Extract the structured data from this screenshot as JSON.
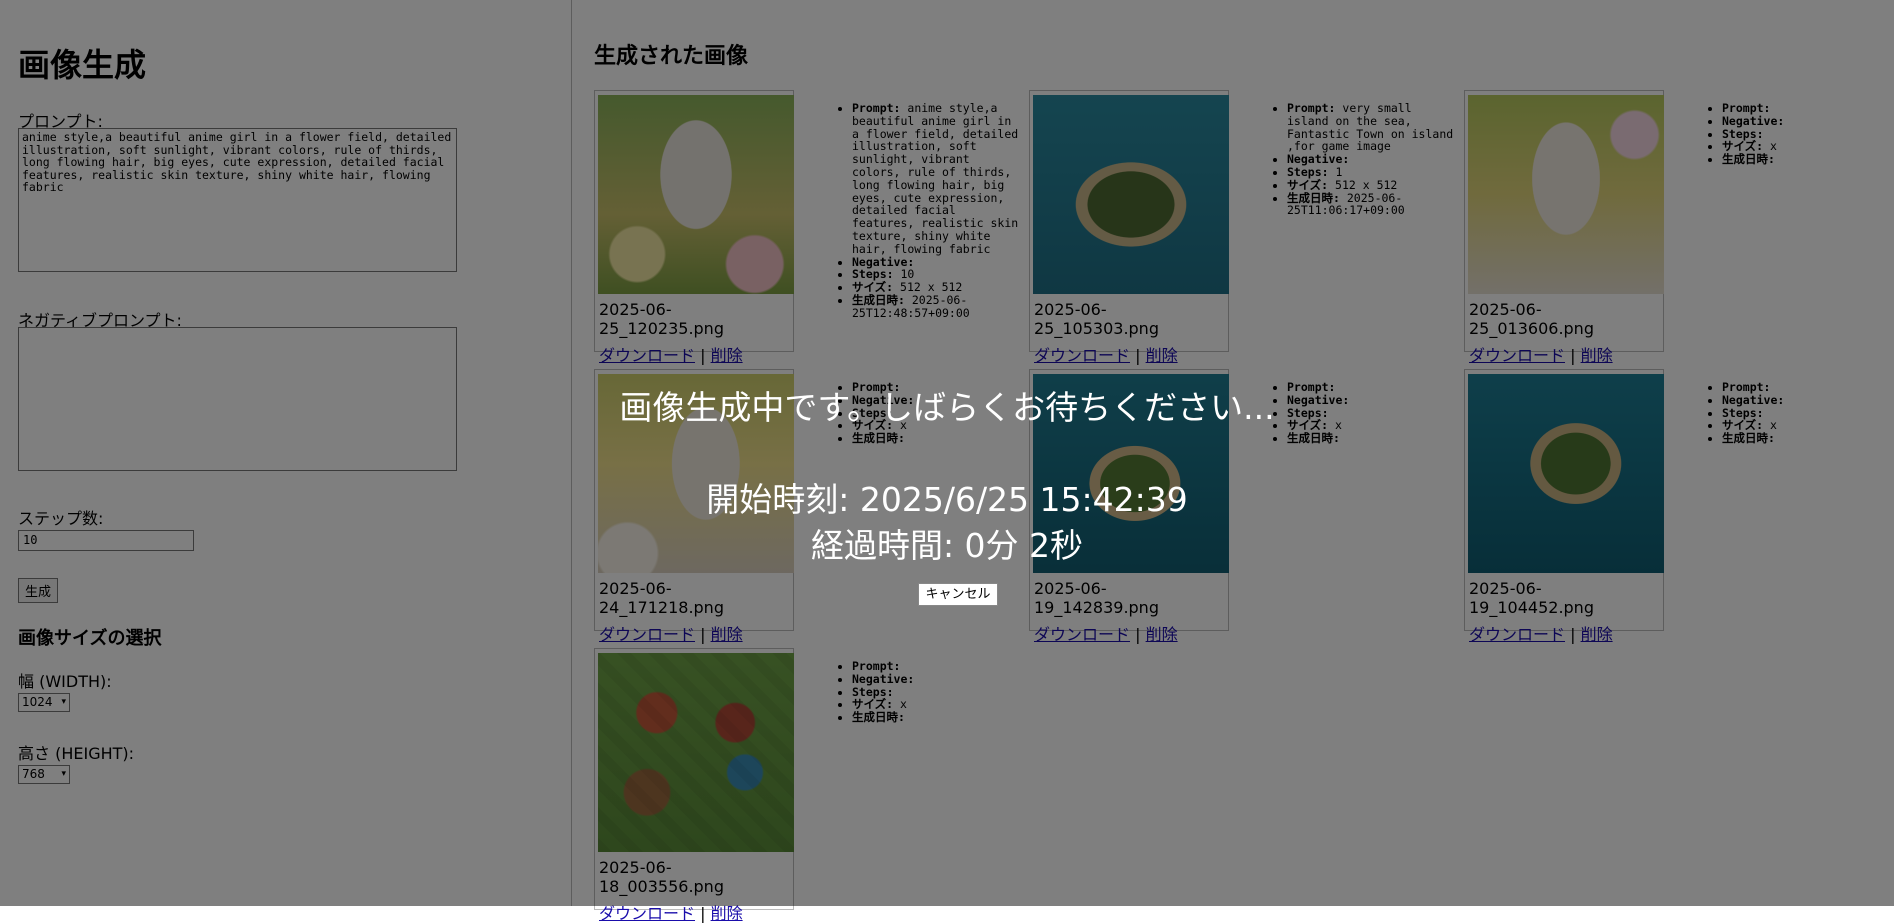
{
  "left": {
    "title": "画像生成",
    "prompt_label": "プロンプト:",
    "prompt_value": "anime style,a beautiful anime girl in a flower field, detailed illustration, soft sunlight, vibrant colors, rule of thirds, long flowing hair, big eyes, cute expression, detailed facial features, realistic skin texture, shiny white hair, flowing fabric",
    "negative_label": "ネガティブプロンプト:",
    "negative_value": "",
    "steps_label": "ステップ数:",
    "steps_value": "10",
    "generate_button": "生成",
    "size_heading": "画像サイズの選択",
    "width_label": "幅 (WIDTH):",
    "width_value": "1024",
    "height_label": "高さ (HEIGHT):",
    "height_value": "768"
  },
  "gallery": {
    "title": "生成された画像",
    "download_label": "ダウンロード",
    "separator": "|",
    "delete_label": "削除",
    "meta_labels": {
      "prompt": "Prompt:",
      "negative": "Negative:",
      "steps": "Steps:",
      "size": "サイズ:",
      "created": "生成日時:"
    },
    "items": [
      {
        "filename": "2025-06-25_120235.png",
        "thumb": "anime-girl-flower-field",
        "prompt": "anime style,a beautiful anime girl in a flower field, detailed illustration, soft sunlight, vibrant colors, rule of thirds, long flowing hair, big eyes, cute expression, detailed facial features, realistic skin texture, shiny white hair, flowing fabric",
        "negative": "",
        "steps": "10",
        "size": "512 x 512",
        "created": "2025-06-25T12:48:57+09:00"
      },
      {
        "filename": "2025-06-25_105303.png",
        "thumb": "island-top-view",
        "prompt": "very small island on the sea, Fantastic Town on island ,for game image",
        "negative": "",
        "steps": "1",
        "size": "512 x 512",
        "created": "2025-06-25T11:06:17+09:00"
      },
      {
        "filename": "2025-06-25_013606.png",
        "thumb": "anime-girl-daisies",
        "prompt": "",
        "negative": "",
        "steps": "",
        "size": "x",
        "created": ""
      },
      {
        "filename": "2025-06-24_171218.png",
        "thumb": "anime-girl-daisies-2",
        "prompt": "",
        "negative": "",
        "steps": "",
        "size": "x",
        "created": ""
      },
      {
        "filename": "2025-06-19_142839.png",
        "thumb": "island-palm-trees",
        "prompt": "",
        "negative": "",
        "steps": "",
        "size": "x",
        "created": ""
      },
      {
        "filename": "2025-06-19_104452.png",
        "thumb": "island-house",
        "prompt": "",
        "negative": "",
        "steps": "",
        "size": "x",
        "created": ""
      },
      {
        "filename": "2025-06-18_003556.png",
        "thumb": "isometric-town",
        "prompt": "",
        "negative": "",
        "steps": "",
        "size": "x",
        "created": ""
      }
    ]
  },
  "overlay": {
    "message": "画像生成中です。しばらくお待ちください...",
    "start_time": "開始時刻: 2025/6/25 15:42:39",
    "elapsed": "経過時間: 0分 2秒",
    "cancel_label": "キャンセル"
  }
}
